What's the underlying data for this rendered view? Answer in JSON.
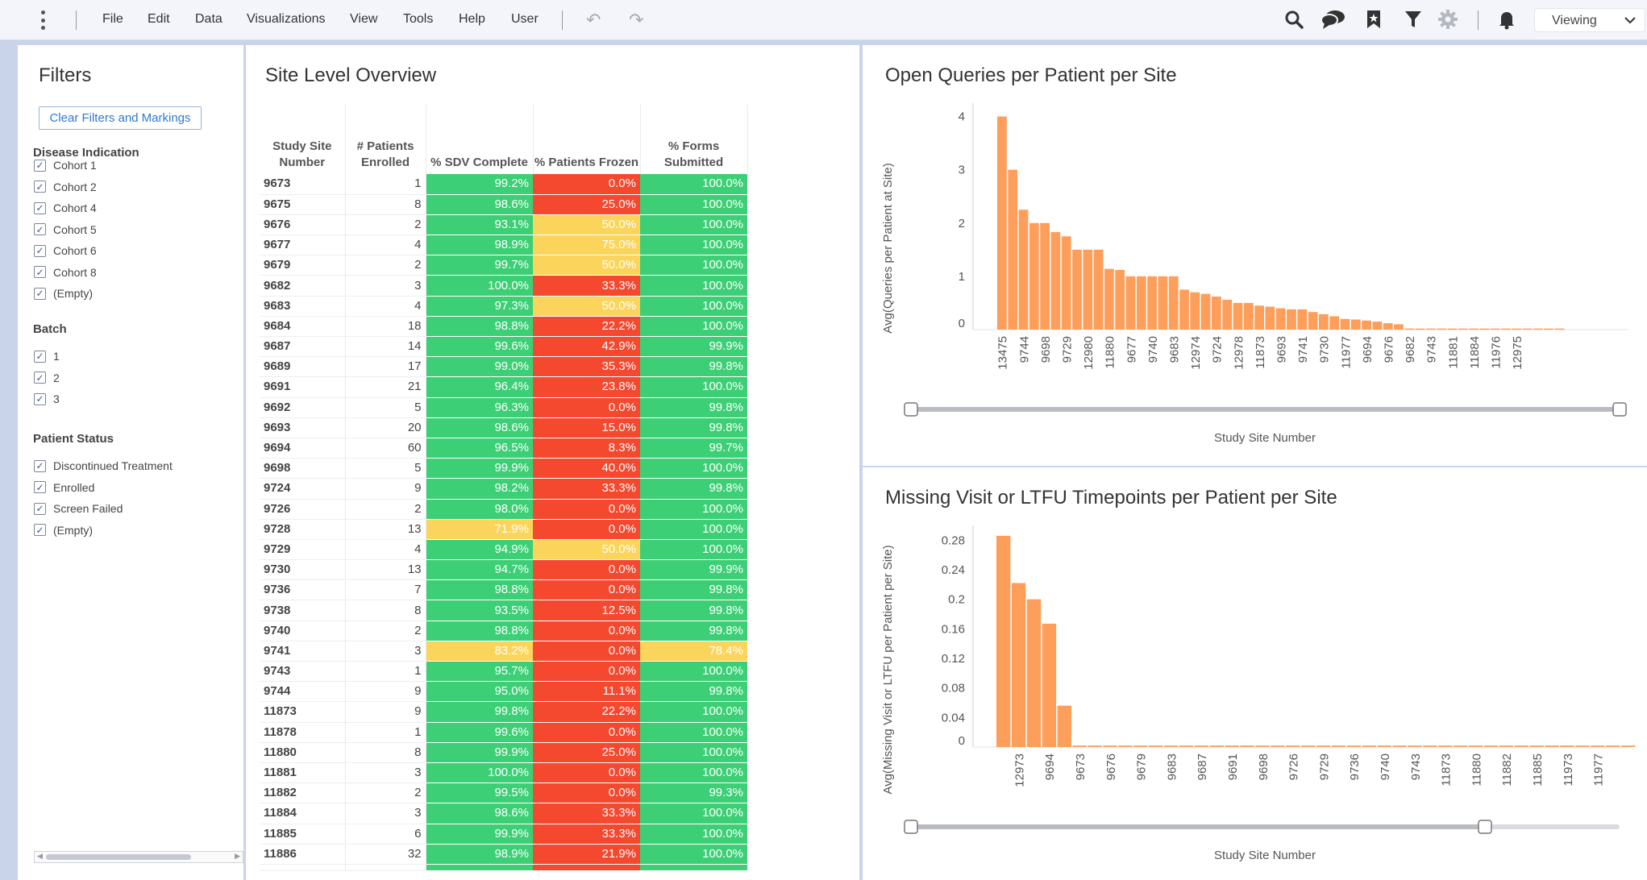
{
  "menubar": {
    "items": [
      "File",
      "Edit",
      "Data",
      "Visualizations",
      "View",
      "Tools",
      "Help",
      "User"
    ],
    "undo_icon": "undo-icon",
    "redo_icon": "redo-icon",
    "tools": [
      "search-icon",
      "comments-icon",
      "bookmark-icon",
      "filter-icon",
      "settings-icon",
      "notification-bell-icon"
    ],
    "mode": "Viewing"
  },
  "filters": {
    "title": "Filters",
    "clear_button": "Clear Filters and Markings",
    "groups": [
      {
        "title": "Disease Indication",
        "options": [
          "Cohort 1",
          "Cohort 2",
          "Cohort 4",
          "Cohort 5",
          "Cohort 6",
          "Cohort 8",
          "(Empty)"
        ]
      },
      {
        "title": "Batch",
        "options": [
          "1",
          "2",
          "3"
        ]
      },
      {
        "title": "Patient Status",
        "options": [
          "Discontinued Treatment",
          "Enrolled",
          "Screen Failed",
          "(Empty)"
        ]
      }
    ]
  },
  "table": {
    "title": "Site Level Overview",
    "columns": [
      "Study Site Number",
      "# Patients Enrolled",
      "% SDV Complete",
      "% Patients Frozen",
      "% Forms Submitted"
    ],
    "colors": {
      "green": "#3ccf75",
      "red": "#f4482f",
      "yellow": "#fbd55b"
    },
    "rows": [
      [
        "9673",
        "1",
        "99.2%",
        "0.0%",
        "100.0%"
      ],
      [
        "9675",
        "8",
        "98.6%",
        "25.0%",
        "100.0%"
      ],
      [
        "9676",
        "2",
        "93.1%",
        "50.0%",
        "100.0%"
      ],
      [
        "9677",
        "4",
        "98.9%",
        "75.0%",
        "100.0%"
      ],
      [
        "9679",
        "2",
        "99.7%",
        "50.0%",
        "100.0%"
      ],
      [
        "9682",
        "3",
        "100.0%",
        "33.3%",
        "100.0%"
      ],
      [
        "9683",
        "4",
        "97.3%",
        "50.0%",
        "100.0%"
      ],
      [
        "9684",
        "18",
        "98.8%",
        "22.2%",
        "100.0%"
      ],
      [
        "9687",
        "14",
        "99.6%",
        "42.9%",
        "99.9%"
      ],
      [
        "9689",
        "17",
        "99.0%",
        "35.3%",
        "99.8%"
      ],
      [
        "9691",
        "21",
        "96.4%",
        "23.8%",
        "100.0%"
      ],
      [
        "9692",
        "5",
        "96.3%",
        "0.0%",
        "99.8%"
      ],
      [
        "9693",
        "20",
        "98.6%",
        "15.0%",
        "99.8%"
      ],
      [
        "9694",
        "60",
        "96.5%",
        "8.3%",
        "99.7%"
      ],
      [
        "9698",
        "5",
        "99.9%",
        "40.0%",
        "100.0%"
      ],
      [
        "9724",
        "9",
        "98.2%",
        "33.3%",
        "99.8%"
      ],
      [
        "9726",
        "2",
        "98.0%",
        "0.0%",
        "100.0%"
      ],
      [
        "9728",
        "13",
        "71.9%",
        "0.0%",
        "100.0%"
      ],
      [
        "9729",
        "4",
        "94.9%",
        "50.0%",
        "100.0%"
      ],
      [
        "9730",
        "13",
        "94.7%",
        "0.0%",
        "99.9%"
      ],
      [
        "9736",
        "7",
        "98.8%",
        "0.0%",
        "99.8%"
      ],
      [
        "9738",
        "8",
        "93.5%",
        "12.5%",
        "99.8%"
      ],
      [
        "9740",
        "2",
        "98.8%",
        "0.0%",
        "99.8%"
      ],
      [
        "9741",
        "3",
        "83.2%",
        "0.0%",
        "78.4%"
      ],
      [
        "9743",
        "1",
        "95.7%",
        "0.0%",
        "100.0%"
      ],
      [
        "9744",
        "9",
        "95.0%",
        "11.1%",
        "99.8%"
      ],
      [
        "11873",
        "9",
        "99.8%",
        "22.2%",
        "100.0%"
      ],
      [
        "11878",
        "1",
        "99.6%",
        "0.0%",
        "100.0%"
      ],
      [
        "11880",
        "8",
        "99.9%",
        "25.0%",
        "100.0%"
      ],
      [
        "11881",
        "3",
        "100.0%",
        "0.0%",
        "100.0%"
      ],
      [
        "11882",
        "2",
        "99.5%",
        "0.0%",
        "99.3%"
      ],
      [
        "11884",
        "3",
        "98.6%",
        "33.3%",
        "100.0%"
      ],
      [
        "11885",
        "6",
        "99.9%",
        "33.3%",
        "100.0%"
      ],
      [
        "11886",
        "32",
        "98.9%",
        "21.9%",
        "100.0%"
      ]
    ],
    "cell_colors": [
      [
        "green",
        "red",
        "green"
      ],
      [
        "green",
        "red",
        "green"
      ],
      [
        "green",
        "yellow",
        "green"
      ],
      [
        "green",
        "yellow",
        "green"
      ],
      [
        "green",
        "yellow",
        "green"
      ],
      [
        "green",
        "red",
        "green"
      ],
      [
        "green",
        "yellow",
        "green"
      ],
      [
        "green",
        "red",
        "green"
      ],
      [
        "green",
        "red",
        "green"
      ],
      [
        "green",
        "red",
        "green"
      ],
      [
        "green",
        "red",
        "green"
      ],
      [
        "green",
        "red",
        "green"
      ],
      [
        "green",
        "red",
        "green"
      ],
      [
        "green",
        "red",
        "green"
      ],
      [
        "green",
        "red",
        "green"
      ],
      [
        "green",
        "red",
        "green"
      ],
      [
        "green",
        "red",
        "green"
      ],
      [
        "yellow",
        "red",
        "green"
      ],
      [
        "green",
        "yellow",
        "green"
      ],
      [
        "green",
        "red",
        "green"
      ],
      [
        "green",
        "red",
        "green"
      ],
      [
        "green",
        "red",
        "green"
      ],
      [
        "green",
        "red",
        "green"
      ],
      [
        "yellow",
        "red",
        "yellow"
      ],
      [
        "green",
        "red",
        "green"
      ],
      [
        "green",
        "red",
        "green"
      ],
      [
        "green",
        "red",
        "green"
      ],
      [
        "green",
        "red",
        "green"
      ],
      [
        "green",
        "red",
        "green"
      ],
      [
        "green",
        "red",
        "green"
      ],
      [
        "green",
        "red",
        "green"
      ],
      [
        "green",
        "red",
        "green"
      ],
      [
        "green",
        "red",
        "green"
      ],
      [
        "green",
        "red",
        "green"
      ]
    ]
  },
  "chart_data": [
    {
      "type": "bar",
      "title": "Open Queries per Patient per Site",
      "xlabel": "Study Site Number",
      "ylabel": "Avg(Queries per Patient at Site)",
      "ylim": [
        0,
        4.25
      ],
      "yticks": [
        0,
        1,
        2,
        3,
        4
      ],
      "color": "#fd9e5b",
      "categories": [
        "13475",
        "",
        "9744",
        "",
        "9698",
        "",
        "9729",
        "",
        "12980",
        "",
        "11880",
        "",
        "9677",
        "",
        "9740",
        "",
        "9683",
        "",
        "12974",
        "",
        "9724",
        "",
        "12978",
        "",
        "11873",
        "",
        "9693",
        "",
        "9741",
        "",
        "9730",
        "",
        "11977",
        "",
        "9694",
        "",
        "9676",
        "",
        "9682",
        "",
        "9743",
        "",
        "11881",
        "",
        "11884",
        "",
        "11976",
        "",
        "12975",
        ""
      ],
      "values": [
        4.0,
        3.0,
        2.25,
        2.0,
        2.0,
        1.83,
        1.75,
        1.5,
        1.5,
        1.5,
        1.14,
        1.12,
        1.0,
        1.0,
        1.0,
        1.0,
        1.0,
        0.75,
        0.7,
        0.67,
        0.62,
        0.56,
        0.5,
        0.5,
        0.45,
        0.43,
        0.4,
        0.38,
        0.38,
        0.33,
        0.29,
        0.25,
        0.2,
        0.19,
        0.17,
        0.15,
        0.12,
        0.1,
        0.02,
        0.02,
        0.02,
        0.02,
        0.02,
        0.02,
        0.02,
        0.02,
        0.02,
        0.02,
        0.02,
        0.02,
        0.02,
        0.02,
        0.02
      ],
      "slider_positions": [
        0.0,
        1.0
      ]
    },
    {
      "type": "bar",
      "title": "Missing Visit or LTFU Timepoints per Patient per Site",
      "xlabel": "Study Site Number",
      "ylabel": "Avg(Missing Visit or LTFU per Patient per Site)",
      "ylim": [
        0,
        0.3
      ],
      "yticks": [
        "0",
        "0.04",
        "0.08",
        "0.12",
        "0.16",
        "0.2",
        "0.24",
        "0.28"
      ],
      "color": "#fd9e5b",
      "categories": [
        "",
        "12973",
        "",
        "9694",
        "",
        "9673",
        "",
        "9676",
        "",
        "9679",
        "",
        "9683",
        "",
        "9687",
        "",
        "9691",
        "",
        "9698",
        "",
        "9726",
        "",
        "9729",
        "",
        "9736",
        "",
        "9740",
        "",
        "9743",
        "",
        "11873",
        "",
        "11880",
        "",
        "11882",
        "",
        "11885",
        "",
        "11973",
        "",
        "11977",
        "",
        ""
      ],
      "values": [
        0.286,
        0.222,
        0.2,
        0.167,
        0.056,
        0.002,
        0.002,
        0.002,
        0.002,
        0.002,
        0.002,
        0.002,
        0.002,
        0.002,
        0.002,
        0.002,
        0.002,
        0.002,
        0.002,
        0.002,
        0.002,
        0.002,
        0.002,
        0.002,
        0.002,
        0.002,
        0.002,
        0.002,
        0.002,
        0.002,
        0.002,
        0.002,
        0.002,
        0.002,
        0.002,
        0.002,
        0.002,
        0.002,
        0.002,
        0.002,
        0.002,
        0.002
      ],
      "slider_positions": [
        0.0,
        0.81
      ]
    }
  ]
}
